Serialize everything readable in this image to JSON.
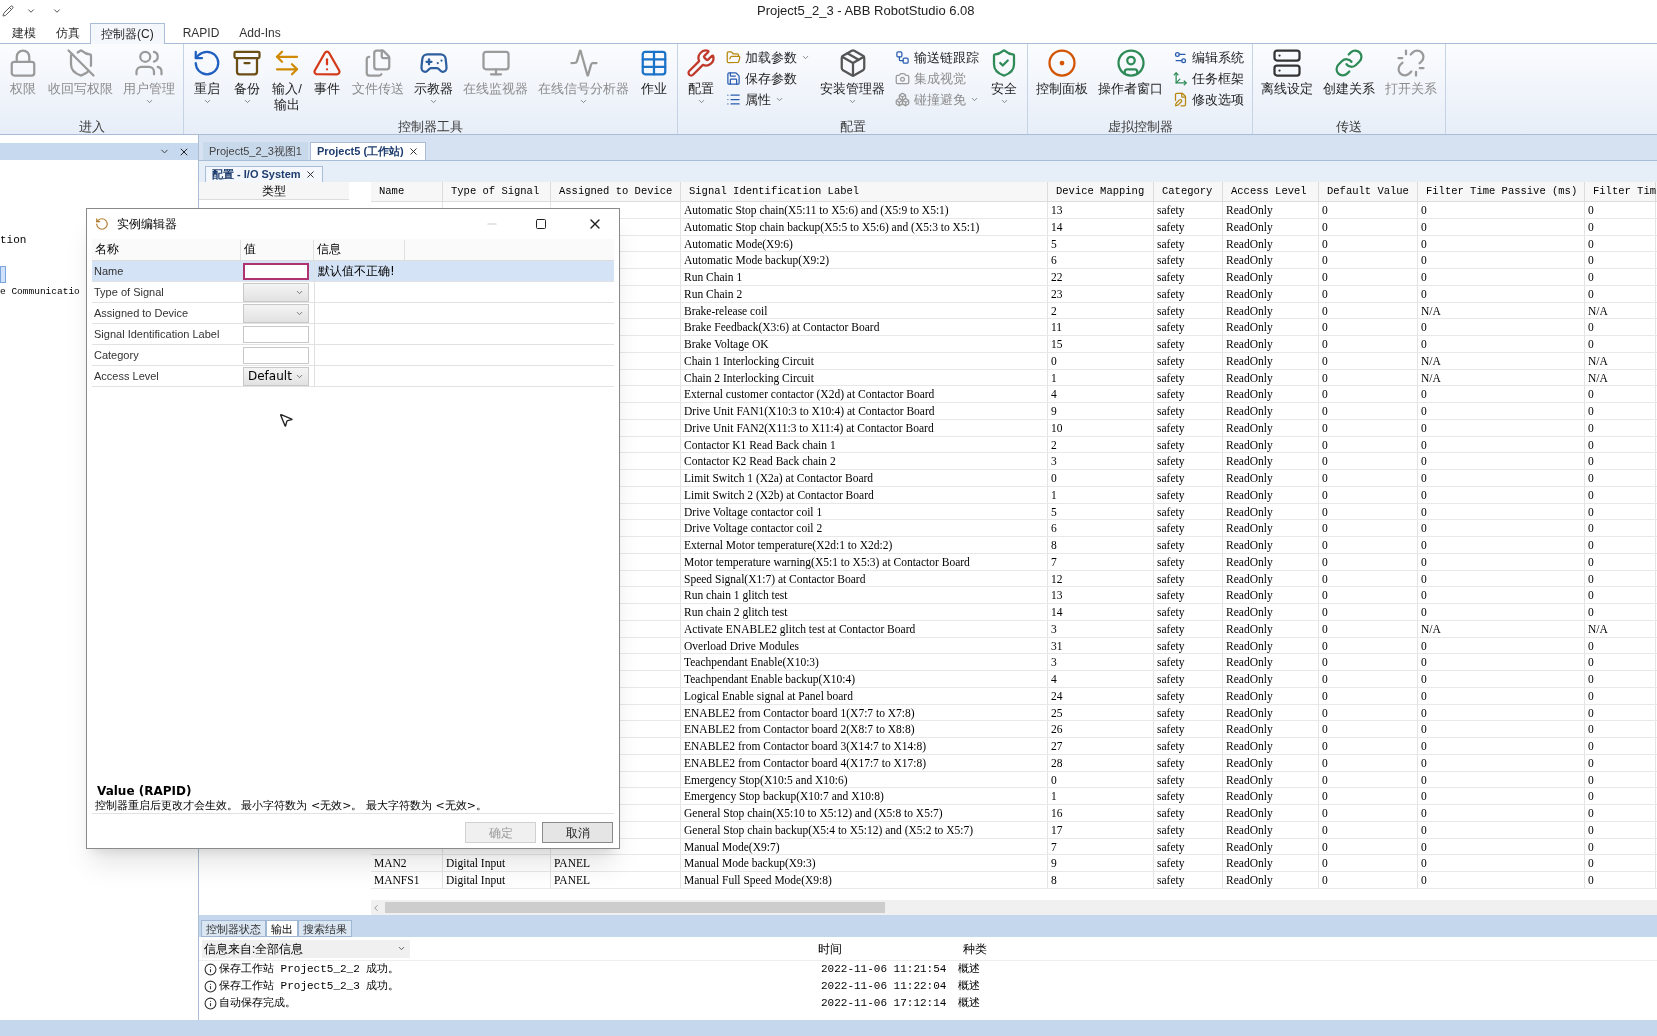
{
  "window": {
    "title": "Project5_2_3 - ABB RobotStudio 6.08"
  },
  "menu_tabs": [
    {
      "label": "建模",
      "selected": false
    },
    {
      "label": "仿真",
      "selected": false
    },
    {
      "label": "控制器(C)",
      "selected": true
    },
    {
      "label": "RAPID",
      "selected": false
    },
    {
      "label": "Add-Ins",
      "selected": false
    }
  ],
  "ribbon": [
    {
      "label": "进入",
      "items": [
        {
          "label": "权限",
          "kind": "large",
          "disabled": true,
          "dropdown": false
        },
        {
          "label": "收回写权限",
          "kind": "large",
          "disabled": true,
          "dropdown": false
        },
        {
          "label": "用户管理",
          "kind": "large",
          "disabled": true,
          "dropdown": true
        }
      ]
    },
    {
      "label": "控制器工具",
      "items": [
        {
          "label": "重启",
          "kind": "large",
          "disabled": false,
          "dropdown": true
        },
        {
          "label": "备份",
          "kind": "large",
          "disabled": false,
          "dropdown": true
        },
        {
          "label": "输入/\n输出",
          "kind": "large",
          "disabled": false,
          "dropdown": false
        },
        {
          "label": "事件",
          "kind": "large",
          "disabled": false,
          "dropdown": false
        },
        {
          "label": "文件传送",
          "kind": "large",
          "disabled": true,
          "dropdown": false
        },
        {
          "label": "示教器",
          "kind": "large",
          "disabled": false,
          "dropdown": true
        },
        {
          "label": "在线监视器",
          "kind": "large",
          "disabled": true,
          "dropdown": false
        },
        {
          "label": "在线信号分析器",
          "kind": "large",
          "disabled": true,
          "dropdown": true
        },
        {
          "label": "作业",
          "kind": "large",
          "disabled": false,
          "dropdown": false
        }
      ]
    },
    {
      "label": "配置",
      "items": [
        {
          "label": "配置",
          "kind": "large",
          "disabled": false,
          "dropdown": true
        },
        {
          "label": "加载参数",
          "kind": "small",
          "disabled": false,
          "dropdown": true
        },
        {
          "label": "保存参数",
          "kind": "small",
          "disabled": false,
          "dropdown": false
        },
        {
          "label": "属性",
          "kind": "small",
          "disabled": false,
          "dropdown": true
        },
        {
          "label": "安装管理器",
          "kind": "large",
          "disabled": false,
          "dropdown": true
        },
        {
          "label": "输送链跟踪",
          "kind": "small",
          "disabled": false,
          "dropdown": false
        },
        {
          "label": "集成视觉",
          "kind": "small",
          "disabled": true,
          "dropdown": false
        },
        {
          "label": "碰撞避免",
          "kind": "small",
          "disabled": true,
          "dropdown": true
        },
        {
          "label": "安全",
          "kind": "large",
          "disabled": false,
          "dropdown": true
        }
      ]
    },
    {
      "label": "虚拟控制器",
      "items": [
        {
          "label": "控制面板",
          "kind": "large",
          "disabled": false,
          "dropdown": false
        },
        {
          "label": "操作者窗口",
          "kind": "large",
          "disabled": false,
          "dropdown": false
        },
        {
          "label": "编辑系统",
          "kind": "small",
          "disabled": false,
          "dropdown": false
        },
        {
          "label": "任务框架",
          "kind": "small",
          "disabled": false,
          "dropdown": false
        },
        {
          "label": "修改选项",
          "kind": "small",
          "disabled": false,
          "dropdown": false
        }
      ]
    },
    {
      "label": "传送",
      "items": [
        {
          "label": "离线设定",
          "kind": "large",
          "disabled": false,
          "dropdown": false
        },
        {
          "label": "创建关系",
          "kind": "large",
          "disabled": false,
          "dropdown": false
        },
        {
          "label": "打开关系",
          "kind": "large",
          "disabled": true,
          "dropdown": false
        }
      ]
    }
  ],
  "left_panel": {
    "items": [
      "tion",
      "e Communicatio"
    ]
  },
  "doc_tabs": [
    {
      "label": "Project5_2_3视图1",
      "selected": false
    },
    {
      "label": "Project5 (工作站)",
      "selected": true
    }
  ],
  "sub_tab": {
    "label": "配置 - I/O System"
  },
  "type_list": {
    "header": "类型"
  },
  "table": {
    "columns": [
      "Name",
      "Type of Signal",
      "Assigned to Device",
      "Signal Identification Label",
      "Device Mapping",
      "Category",
      "Access Level",
      "Default Value",
      "Filter Time Passive (ms)",
      "Filter Tim"
    ],
    "rows": [
      {
        "label": "Automatic Stop chain(X5:11 to X5:6) and (X5:9 to X5:1)",
        "mapping": "13",
        "category": "safety",
        "access": "ReadOnly",
        "default": "0",
        "passive": "0",
        "column_10": "0"
      },
      {
        "label": "Automatic Stop chain backup(X5:5 to X5:6) and (X5:3 to X5:1)",
        "mapping": "14",
        "category": "safety",
        "access": "ReadOnly",
        "default": "0",
        "passive": "0",
        "column_10": "0"
      },
      {
        "label": "Automatic Mode(X9:6)",
        "mapping": "5",
        "category": "safety",
        "access": "ReadOnly",
        "default": "0",
        "passive": "0",
        "column_10": "0"
      },
      {
        "label": "Automatic Mode backup(X9:2)",
        "mapping": "6",
        "category": "safety",
        "access": "ReadOnly",
        "default": "0",
        "passive": "0",
        "column_10": "0"
      },
      {
        "label": "Run Chain 1",
        "mapping": "22",
        "category": "safety",
        "access": "ReadOnly",
        "default": "0",
        "passive": "0",
        "column_10": "0"
      },
      {
        "label": "Run Chain 2",
        "mapping": "23",
        "category": "safety",
        "access": "ReadOnly",
        "default": "0",
        "passive": "0",
        "column_10": "0"
      },
      {
        "label": "Brake-release coil",
        "mapping": "2",
        "category": "safety",
        "access": "ReadOnly",
        "default": "0",
        "passive": "N/A",
        "column_10": "N/A"
      },
      {
        "label": "Brake Feedback(X3:6) at Contactor Board",
        "mapping": "11",
        "category": "safety",
        "access": "ReadOnly",
        "default": "0",
        "passive": "0",
        "column_10": "0"
      },
      {
        "label": "Brake Voltage OK",
        "mapping": "15",
        "category": "safety",
        "access": "ReadOnly",
        "default": "0",
        "passive": "0",
        "column_10": "0"
      },
      {
        "label": "Chain 1 Interlocking Circuit",
        "mapping": "0",
        "category": "safety",
        "access": "ReadOnly",
        "default": "0",
        "passive": "N/A",
        "column_10": "N/A"
      },
      {
        "label": "Chain 2 Interlocking Circuit",
        "mapping": "1",
        "category": "safety",
        "access": "ReadOnly",
        "default": "0",
        "passive": "N/A",
        "column_10": "N/A"
      },
      {
        "label": "External customer contactor (X2d) at Contactor Board",
        "mapping": "4",
        "category": "safety",
        "access": "ReadOnly",
        "default": "0",
        "passive": "0",
        "column_10": "0"
      },
      {
        "label": "Drive Unit FAN1(X10:3 to X10:4) at Contactor Board",
        "mapping": "9",
        "category": "safety",
        "access": "ReadOnly",
        "default": "0",
        "passive": "0",
        "column_10": "0"
      },
      {
        "label": "Drive Unit FAN2(X11:3 to X11:4) at Contactor Board",
        "mapping": "10",
        "category": "safety",
        "access": "ReadOnly",
        "default": "0",
        "passive": "0",
        "column_10": "0"
      },
      {
        "label": "Contactor K1 Read Back chain 1",
        "mapping": "2",
        "category": "safety",
        "access": "ReadOnly",
        "default": "0",
        "passive": "0",
        "column_10": "0"
      },
      {
        "label": "Contactor K2 Read Back chain 2",
        "mapping": "3",
        "category": "safety",
        "access": "ReadOnly",
        "default": "0",
        "passive": "0",
        "column_10": "0"
      },
      {
        "label": "Limit Switch 1 (X2a) at Contactor Board",
        "mapping": "0",
        "category": "safety",
        "access": "ReadOnly",
        "default": "0",
        "passive": "0",
        "column_10": "0"
      },
      {
        "label": "Limit Switch 2 (X2b) at Contactor Board",
        "mapping": "1",
        "category": "safety",
        "access": "ReadOnly",
        "default": "0",
        "passive": "0",
        "column_10": "0"
      },
      {
        "label": "Drive Voltage contactor coil 1",
        "mapping": "5",
        "category": "safety",
        "access": "ReadOnly",
        "default": "0",
        "passive": "0",
        "column_10": "0"
      },
      {
        "label": "Drive Voltage contactor coil 2",
        "mapping": "6",
        "category": "safety",
        "access": "ReadOnly",
        "default": "0",
        "passive": "0",
        "column_10": "0"
      },
      {
        "label": "External Motor temperature(X2d:1 to X2d:2)",
        "mapping": "8",
        "category": "safety",
        "access": "ReadOnly",
        "default": "0",
        "passive": "0",
        "column_10": "0"
      },
      {
        "label": "Motor temperature warning(X5:1 to X5:3) at Contactor Board",
        "mapping": "7",
        "category": "safety",
        "access": "ReadOnly",
        "default": "0",
        "passive": "0",
        "column_10": "0"
      },
      {
        "label": "Speed Signal(X1:7) at Contactor Board",
        "mapping": "12",
        "category": "safety",
        "access": "ReadOnly",
        "default": "0",
        "passive": "0",
        "column_10": "0"
      },
      {
        "label": "Run chain 1 glitch test",
        "mapping": "13",
        "category": "safety",
        "access": "ReadOnly",
        "default": "0",
        "passive": "0",
        "column_10": "0"
      },
      {
        "label": "Run chain 2 glitch test",
        "mapping": "14",
        "category": "safety",
        "access": "ReadOnly",
        "default": "0",
        "passive": "0",
        "column_10": "0"
      },
      {
        "label": "Activate ENABLE2 glitch test at Contactor Board",
        "mapping": "3",
        "category": "safety",
        "access": "ReadOnly",
        "default": "0",
        "passive": "N/A",
        "column_10": "N/A"
      },
      {
        "label": "Overload Drive Modules",
        "mapping": "31",
        "category": "safety",
        "access": "ReadOnly",
        "default": "0",
        "passive": "0",
        "column_10": "0"
      },
      {
        "label": "Teachpendant  Enable(X10:3)",
        "mapping": "3",
        "category": "safety",
        "access": "ReadOnly",
        "default": "0",
        "passive": "0",
        "column_10": "0"
      },
      {
        "label": "Teachpendant  Enable backup(X10:4)",
        "mapping": "4",
        "category": "safety",
        "access": "ReadOnly",
        "default": "0",
        "passive": "0",
        "column_10": "0"
      },
      {
        "label": "Logical Enable signal at Panel board",
        "mapping": "24",
        "category": "safety",
        "access": "ReadOnly",
        "default": "0",
        "passive": "0",
        "column_10": "0"
      },
      {
        "label": "ENABLE2 from Contactor board 1(X7:7 to X7:8)",
        "mapping": "25",
        "category": "safety",
        "access": "ReadOnly",
        "default": "0",
        "passive": "0",
        "column_10": "0"
      },
      {
        "label": "ENABLE2 from Contactor board 2(X8:7 to X8:8)",
        "mapping": "26",
        "category": "safety",
        "access": "ReadOnly",
        "default": "0",
        "passive": "0",
        "column_10": "0"
      },
      {
        "label": "ENABLE2 from Contactor board 3(X14:7 to X14:8)",
        "mapping": "27",
        "category": "safety",
        "access": "ReadOnly",
        "default": "0",
        "passive": "0",
        "column_10": "0"
      },
      {
        "label": "ENABLE2 from Contactor board 4(X17:7 to X17:8)",
        "mapping": "28",
        "category": "safety",
        "access": "ReadOnly",
        "default": "0",
        "passive": "0",
        "column_10": "0"
      },
      {
        "label": "Emergency  Stop(X10:5 and X10:6)",
        "mapping": "0",
        "category": "safety",
        "access": "ReadOnly",
        "default": "0",
        "passive": "0",
        "column_10": "0"
      },
      {
        "label": "Emergency  Stop backup(X10:7 and X10:8)",
        "mapping": "1",
        "category": "safety",
        "access": "ReadOnly",
        "default": "0",
        "passive": "0",
        "column_10": "0"
      },
      {
        "label": "General Stop chain(X5:10 to X5:12) and (X5:8 to X5:7)",
        "mapping": "16",
        "category": "safety",
        "access": "ReadOnly",
        "default": "0",
        "passive": "0",
        "column_10": "0"
      },
      {
        "label": "General Stop chain backup(X5:4 to X5:12) and (X5:2 to X5:7)",
        "mapping": "17",
        "category": "safety",
        "access": "ReadOnly",
        "default": "0",
        "passive": "0",
        "column_10": "0"
      },
      {
        "label": "Manual Mode(X9:7)",
        "mapping": "7",
        "category": "safety",
        "access": "ReadOnly",
        "default": "0",
        "passive": "0",
        "column_10": "0"
      },
      {
        "name": "MAN2",
        "type": "Digital Input",
        "device": "PANEL",
        "label": "Manual Mode backup(X9:3)",
        "mapping": "9",
        "category": "safety",
        "access": "ReadOnly",
        "default": "0",
        "passive": "0",
        "column_10": "0"
      },
      {
        "name": "MANFS1",
        "type": "Digital Input",
        "device": "PANEL",
        "label": "Manual Full Speed Mode(X9:8)",
        "mapping": "8",
        "category": "safety",
        "access": "ReadOnly",
        "default": "0",
        "passive": "0",
        "column_10": "0"
      }
    ]
  },
  "dialog": {
    "title": "实例编辑器",
    "columns": [
      "名称",
      "值",
      "信息"
    ],
    "rows": [
      {
        "label": "Name",
        "kind": "text",
        "selected": true,
        "invalid": true,
        "info": "默认值不正确!"
      },
      {
        "label": "Type of Signal",
        "kind": "combo",
        "selected": false,
        "invalid": false
      },
      {
        "label": "Assigned to Device",
        "kind": "combo",
        "selected": false,
        "invalid": false
      },
      {
        "label": "Signal Identification Label",
        "kind": "text",
        "selected": false,
        "invalid": false
      },
      {
        "label": "Category",
        "kind": "text",
        "selected": false,
        "invalid": false
      },
      {
        "label": "Access Level",
        "kind": "combo",
        "selected": false,
        "invalid": false,
        "value": "Default"
      }
    ],
    "help_title": "Value (RAPID)",
    "help_text": "控制器重启后更改才会生效。 最小字符数为 <无效>。 最大字符数为 <无效>。",
    "buttons": [
      {
        "label": "确定",
        "disabled": true
      },
      {
        "label": "取消",
        "disabled": false
      }
    ]
  },
  "output_panel": {
    "tabs": [
      {
        "label": "控制器状态",
        "selected": false
      },
      {
        "label": "输出",
        "selected": true
      },
      {
        "label": "搜索结果",
        "selected": false
      }
    ],
    "filter_label": "信息来自:",
    "filter_value": "全部信息",
    "columns": [
      "时间",
      "种类"
    ],
    "messages": [
      {
        "text": "保存工作站 Project5_2_2 成功。",
        "time": "2022-11-06 11:21:54",
        "category": "概述"
      },
      {
        "text": "保存工作站 Project5_2_3 成功。",
        "time": "2022-11-06 11:22:04",
        "category": "概述"
      },
      {
        "text": "自动保存完成。",
        "time": "2022-11-06 17:12:14",
        "category": "概述"
      }
    ]
  }
}
